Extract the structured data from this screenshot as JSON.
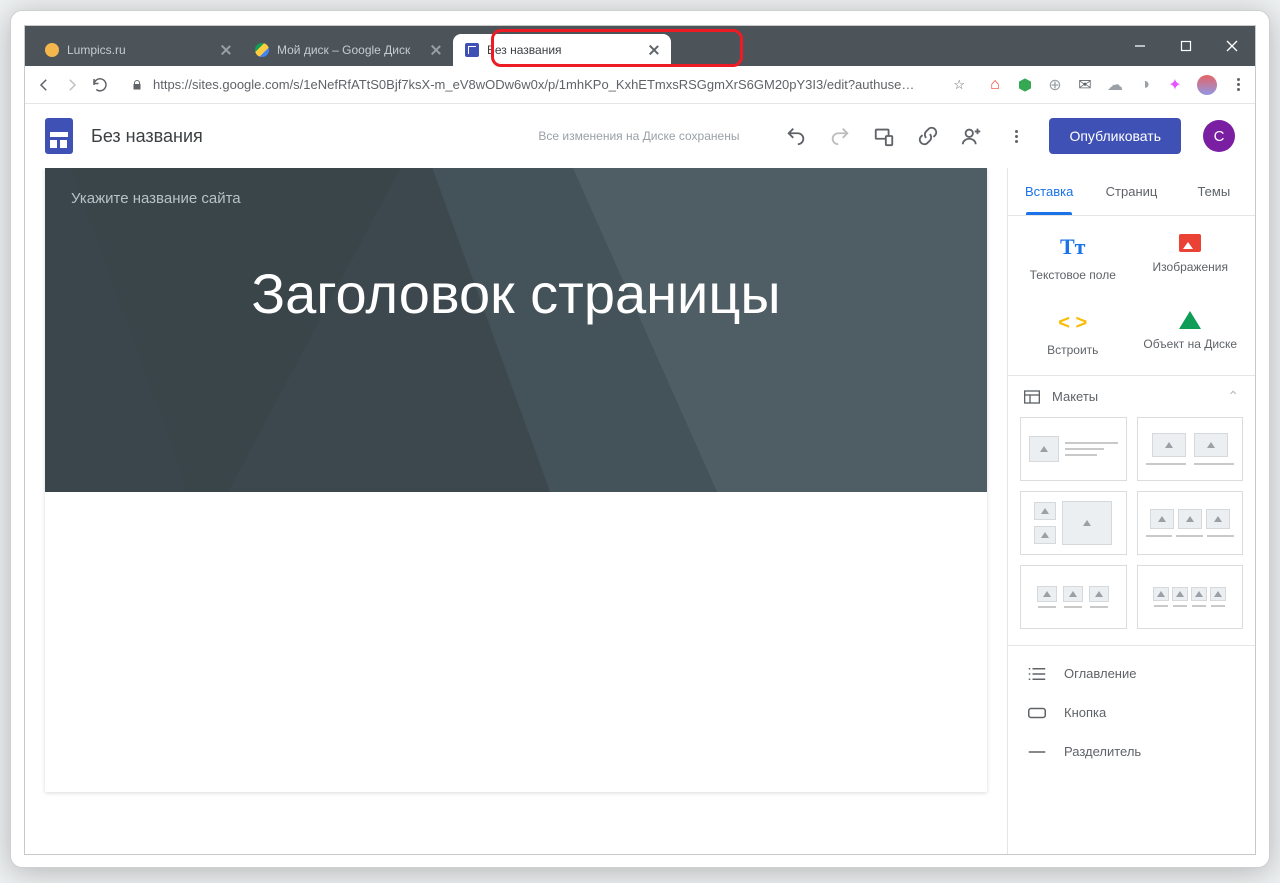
{
  "browser": {
    "tabs": [
      {
        "label": "Lumpics.ru"
      },
      {
        "label": "Мой диск – Google Диск"
      },
      {
        "label": "Без названия"
      }
    ],
    "url": "https://sites.google.com/s/1eNefRfATtS0Bjf7ksX-m_eV8wODw6w0x/p/1mhKPo_KxhETmxsRSGgmXrS6GM20pY3I3/edit?authuse…"
  },
  "header": {
    "title": "Без названия",
    "saved": "Все изменения на Диске сохранены",
    "publish": "Опубликовать",
    "avatar": "С"
  },
  "canvas": {
    "sitename_placeholder": "Укажите название сайта",
    "page_title": "Заголовок страницы"
  },
  "sidebar": {
    "tabs": {
      "insert": "Вставка",
      "pages": "Страниц",
      "themes": "Темы"
    },
    "insert": {
      "textbox": "Текстовое поле",
      "images": "Изображения",
      "embed": "Встроить",
      "drive": "Объект на Диске"
    },
    "layouts": "Макеты",
    "more": {
      "toc": "Оглавление",
      "button": "Кнопка",
      "divider": "Разделитель"
    }
  }
}
